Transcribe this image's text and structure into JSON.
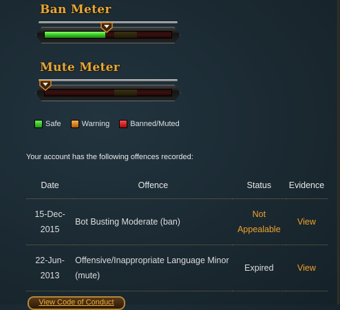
{
  "ban_meter": {
    "title": "Ban Meter",
    "level": 0.48,
    "marker_color": "#e07a1a"
  },
  "mute_meter": {
    "title": "Mute Meter",
    "level": 0.0,
    "marker_color": "#e07a1a"
  },
  "legend": [
    {
      "label": "Safe",
      "color": "#3fcf2a"
    },
    {
      "label": "Warning",
      "color": "#e07a1a"
    },
    {
      "label": "Banned/Muted",
      "color": "#d01818"
    }
  ],
  "intro": "Your account has the following offences recorded:",
  "table": {
    "headers": [
      "Date",
      "Offence",
      "Status",
      "Evidence"
    ],
    "rows": [
      {
        "date": "15-Dec-2015",
        "offence": "Bot Busting Moderate (ban)",
        "status": "Not Appealable",
        "evidence": "View"
      },
      {
        "date": "22-Jun-2013",
        "offence": "Offensive/Inappropriate Language Minor (mute)",
        "status": "Expired",
        "evidence": "View"
      }
    ]
  },
  "code_of_conduct_button": "View Code of Conduct"
}
